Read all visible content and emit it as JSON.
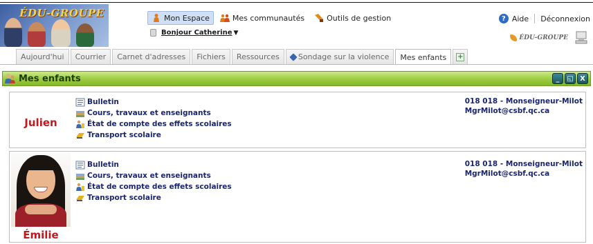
{
  "header": {
    "logo_text": "ÉDU-GROUPE",
    "nav": [
      {
        "label": "Mon Espace",
        "active": true,
        "icon": "person-icon"
      },
      {
        "label": "Mes communautés",
        "active": false,
        "icon": "community-icon"
      },
      {
        "label": "Outils de gestion",
        "active": false,
        "icon": "tools-icon"
      }
    ],
    "greeting": "Bonjour Catherine",
    "help": "Aide",
    "logout": "Déconnexion",
    "brand_small": "ÉDU-GROUPE"
  },
  "tabs": [
    {
      "label": "Aujourd'hui",
      "active": false
    },
    {
      "label": "Courrier",
      "active": false
    },
    {
      "label": "Carnet d'adresses",
      "active": false
    },
    {
      "label": "Fichiers",
      "active": false
    },
    {
      "label": "Ressources",
      "active": false
    },
    {
      "label": "Sondage sur la violence",
      "active": false
    },
    {
      "label": "Mes enfants",
      "active": true
    }
  ],
  "panel": {
    "title": "Mes enfants",
    "buttons": {
      "minimize": "_",
      "restore": "◱",
      "close": "X"
    }
  },
  "children": [
    {
      "name": "Julien",
      "has_photo": false,
      "links": [
        {
          "label": "Bulletin",
          "icon": "bulletin-icon"
        },
        {
          "label": "Cours, travaux et enseignants",
          "icon": "courses-icon"
        },
        {
          "label": "État de compte des effets scolaires",
          "icon": "account-icon"
        },
        {
          "label": "Transport scolaire",
          "icon": "transport-icon"
        }
      ],
      "school_line": "018 018 - Monseigneur-Milot",
      "school_email": "MgrMilot@csbf.qc.ca"
    },
    {
      "name": "Émilie",
      "has_photo": true,
      "links": [
        {
          "label": "Bulletin",
          "icon": "bulletin-icon"
        },
        {
          "label": "Cours, travaux et enseignants",
          "icon": "courses-icon"
        },
        {
          "label": "État de compte des effets scolaires",
          "icon": "account-icon"
        },
        {
          "label": "Transport scolaire",
          "icon": "transport-icon"
        }
      ],
      "school_line": "018 018 - Monseigneur-Milot",
      "school_email": "MgrMilot@csbf.qc.ca"
    }
  ],
  "colors": {
    "panel_green": "#9ccb3e",
    "child_name": "#c0181d",
    "link_blue": "#1a2470",
    "tab_active_bg": "#ffffff"
  }
}
